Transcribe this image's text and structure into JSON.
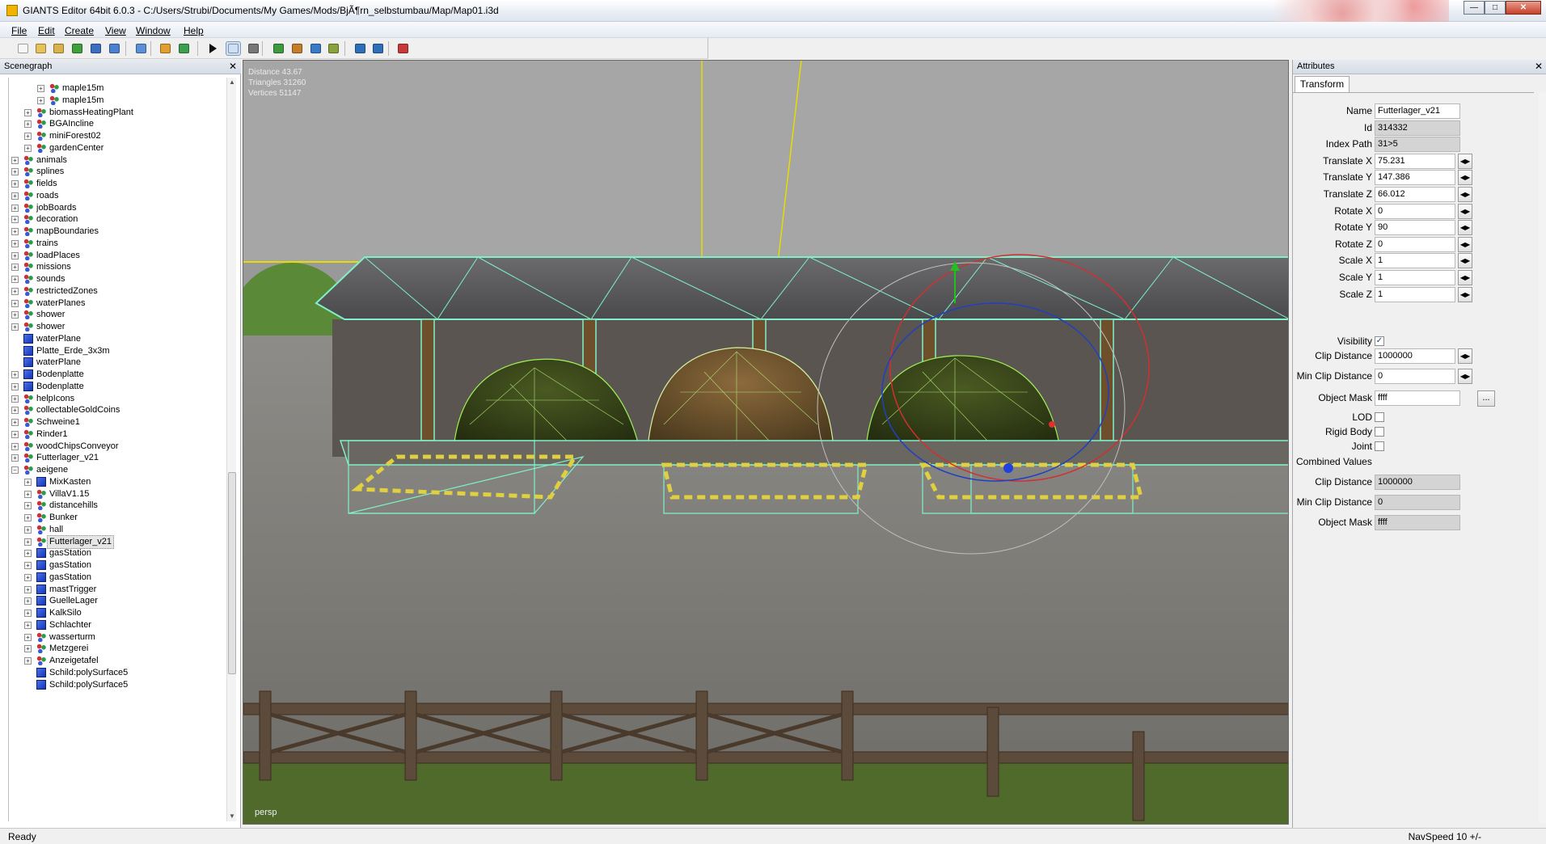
{
  "window": {
    "title": "GIANTS Editor 64bit 6.0.3 - C:/Users/Strubi/Documents/My Games/Mods/BjÃ¶rn_selbstumbau/Map/Map01.i3d",
    "min_label": "—",
    "max_label": "□",
    "close_label": "✕"
  },
  "menu": [
    "File",
    "Edit",
    "Create",
    "View",
    "Window",
    "Help"
  ],
  "toolbar": {
    "buttons": [
      {
        "icon": "new-file-icon",
        "color": "#f6f6f6"
      },
      {
        "icon": "open-folder-icon",
        "color": "#e6c25a"
      },
      {
        "icon": "edit-file-icon",
        "color": "#d9b24a"
      },
      {
        "icon": "refresh-icon",
        "color": "#3f9f3a"
      },
      {
        "icon": "save-icon",
        "color": "#3b6fc2"
      },
      {
        "icon": "save-as-icon",
        "color": "#4b7fd2"
      },
      {
        "icon": "export-icon",
        "color": "#5b8fd8"
      },
      {
        "icon": "undo-icon",
        "color": "#e0a030"
      },
      {
        "icon": "redo-icon",
        "color": "#3aa050"
      },
      {
        "icon": "play-icon",
        "color": "#111111"
      },
      {
        "icon": "select-mode-icon",
        "color": "#cfe0f5"
      },
      {
        "icon": "magnet-icon",
        "color": "#777777"
      },
      {
        "icon": "terrain-paint-icon",
        "color": "#3e9a3e"
      },
      {
        "icon": "terrain-sculpt-icon",
        "color": "#c67d2a"
      },
      {
        "icon": "foliage-icon",
        "color": "#3a78c8"
      },
      {
        "icon": "placement-icon",
        "color": "#8aa23a"
      },
      {
        "icon": "transform-global-icon",
        "color": "#2f6fb8"
      },
      {
        "icon": "transform-local-icon",
        "color": "#2f6fb8"
      },
      {
        "icon": "screenshot-icon",
        "color": "#c83a3a"
      }
    ]
  },
  "scenegraph": {
    "title": "Scenegraph",
    "close": "✕",
    "nodes": [
      {
        "label": "maple15m",
        "depth": 2,
        "icon": "group"
      },
      {
        "label": "maple15m",
        "depth": 2,
        "icon": "group"
      },
      {
        "label": "biomassHeatingPlant",
        "depth": 1,
        "icon": "group"
      },
      {
        "label": "BGAIncline",
        "depth": 1,
        "icon": "group"
      },
      {
        "label": "miniForest02",
        "depth": 1,
        "icon": "group"
      },
      {
        "label": "gardenCenter",
        "depth": 1,
        "icon": "group"
      },
      {
        "label": "animals",
        "depth": 0,
        "icon": "group"
      },
      {
        "label": "splines",
        "depth": 0,
        "icon": "group"
      },
      {
        "label": "fields",
        "depth": 0,
        "icon": "group"
      },
      {
        "label": "roads",
        "depth": 0,
        "icon": "group"
      },
      {
        "label": "jobBoards",
        "depth": 0,
        "icon": "group"
      },
      {
        "label": "decoration",
        "depth": 0,
        "icon": "group"
      },
      {
        "label": "mapBoundaries",
        "depth": 0,
        "icon": "group"
      },
      {
        "label": "trains",
        "depth": 0,
        "icon": "group"
      },
      {
        "label": "loadPlaces",
        "depth": 0,
        "icon": "group"
      },
      {
        "label": "missions",
        "depth": 0,
        "icon": "group"
      },
      {
        "label": "sounds",
        "depth": 0,
        "icon": "group"
      },
      {
        "label": "restrictedZones",
        "depth": 0,
        "icon": "group"
      },
      {
        "label": "waterPlanes",
        "depth": 0,
        "icon": "group"
      },
      {
        "label": "shower",
        "depth": 0,
        "icon": "group"
      },
      {
        "label": "shower",
        "depth": 0,
        "icon": "group"
      },
      {
        "label": "waterPlane",
        "depth": 0,
        "icon": "cube",
        "leaf": true
      },
      {
        "label": "Platte_Erde_3x3m",
        "depth": 0,
        "icon": "cube",
        "leaf": true
      },
      {
        "label": "waterPlane",
        "depth": 0,
        "icon": "cube",
        "leaf": true
      },
      {
        "label": "Bodenplatte",
        "depth": 0,
        "icon": "cube"
      },
      {
        "label": "Bodenplatte",
        "depth": 0,
        "icon": "cube"
      },
      {
        "label": "helpIcons",
        "depth": 0,
        "icon": "group"
      },
      {
        "label": "collectableGoldCoins",
        "depth": 0,
        "icon": "group"
      },
      {
        "label": "Schweine1",
        "depth": 0,
        "icon": "group"
      },
      {
        "label": "Rinder1",
        "depth": 0,
        "icon": "group"
      },
      {
        "label": "woodChipsConveyor",
        "depth": 0,
        "icon": "group"
      },
      {
        "label": "Futterlager_v21",
        "depth": 0,
        "icon": "group"
      },
      {
        "label": "aeigene",
        "depth": 0,
        "icon": "group",
        "expanded": true
      },
      {
        "label": "MixKasten",
        "depth": 1,
        "icon": "cube"
      },
      {
        "label": "VillaV1.15",
        "depth": 1,
        "icon": "group"
      },
      {
        "label": "distancehills",
        "depth": 1,
        "icon": "group"
      },
      {
        "label": "Bunker",
        "depth": 1,
        "icon": "group"
      },
      {
        "label": "hall",
        "depth": 1,
        "icon": "group"
      },
      {
        "label": "Futterlager_v21",
        "depth": 1,
        "icon": "group",
        "selected": true
      },
      {
        "label": "gasStation",
        "depth": 1,
        "icon": "cube"
      },
      {
        "label": "gasStation",
        "depth": 1,
        "icon": "cube"
      },
      {
        "label": "gasStation",
        "depth": 1,
        "icon": "cube"
      },
      {
        "label": "mastTrigger",
        "depth": 1,
        "icon": "cube"
      },
      {
        "label": "GuelleLager",
        "depth": 1,
        "icon": "cube"
      },
      {
        "label": "KalkSilo",
        "depth": 1,
        "icon": "cube"
      },
      {
        "label": "Schlachter",
        "depth": 1,
        "icon": "cube"
      },
      {
        "label": "wasserturm",
        "depth": 1,
        "icon": "group"
      },
      {
        "label": "Metzgerei",
        "depth": 1,
        "icon": "group"
      },
      {
        "label": "Anzeigetafel",
        "depth": 1,
        "icon": "group"
      },
      {
        "label": "Schild:polySurface5",
        "depth": 1,
        "icon": "cube",
        "leaf": true
      },
      {
        "label": "Schild:polySurface5",
        "depth": 1,
        "icon": "cube",
        "leaf": true
      }
    ]
  },
  "viewport": {
    "stats": [
      "Distance 43.67",
      "Triangles 31260",
      "Vertices 51147"
    ],
    "camera": "persp",
    "wire_color": "#7ff0c8"
  },
  "attributes": {
    "title": "Attributes",
    "close": "✕",
    "tab": "Transform",
    "fields": [
      {
        "label": "Name",
        "value": "Futterlager_v21",
        "kind": "text"
      },
      {
        "label": "Id",
        "value": "314332",
        "kind": "ro"
      },
      {
        "label": "Index Path",
        "value": "31>5",
        "kind": "ro"
      },
      {
        "label": "Translate X",
        "value": "75.231",
        "kind": "spin"
      },
      {
        "label": "Translate Y",
        "value": "147.386",
        "kind": "spin"
      },
      {
        "label": "Translate Z",
        "value": "66.012",
        "kind": "spin"
      },
      {
        "label": "Rotate X",
        "value": "0",
        "kind": "spin"
      },
      {
        "label": "Rotate Y",
        "value": "90",
        "kind": "spin"
      },
      {
        "label": "Rotate Z",
        "value": "0",
        "kind": "spin"
      },
      {
        "label": "Scale X",
        "value": "1",
        "kind": "spin"
      },
      {
        "label": "Scale Y",
        "value": "1",
        "kind": "spin"
      },
      {
        "label": "Scale Z",
        "value": "1",
        "kind": "spin"
      }
    ],
    "visibility": {
      "label": "Visibility",
      "checked": true
    },
    "clip_distance": {
      "label": "Clip Distance",
      "value": "1000000"
    },
    "min_clip_distance": {
      "label": "Min Clip Distance",
      "value": "0"
    },
    "object_mask": {
      "label": "Object Mask",
      "value": "ffff",
      "button": "..."
    },
    "lod": {
      "label": "LOD",
      "checked": false
    },
    "rigid_body": {
      "label": "Rigid Body",
      "checked": false
    },
    "joint": {
      "label": "Joint",
      "checked": false
    },
    "combined_title": "Combined Values",
    "combined": [
      {
        "label": "Clip Distance",
        "value": "1000000"
      },
      {
        "label": "Min Clip Distance",
        "value": "0"
      },
      {
        "label": "Object Mask",
        "value": "ffff"
      }
    ]
  },
  "status": {
    "left": "Ready",
    "right": "NavSpeed 10 +/-"
  }
}
